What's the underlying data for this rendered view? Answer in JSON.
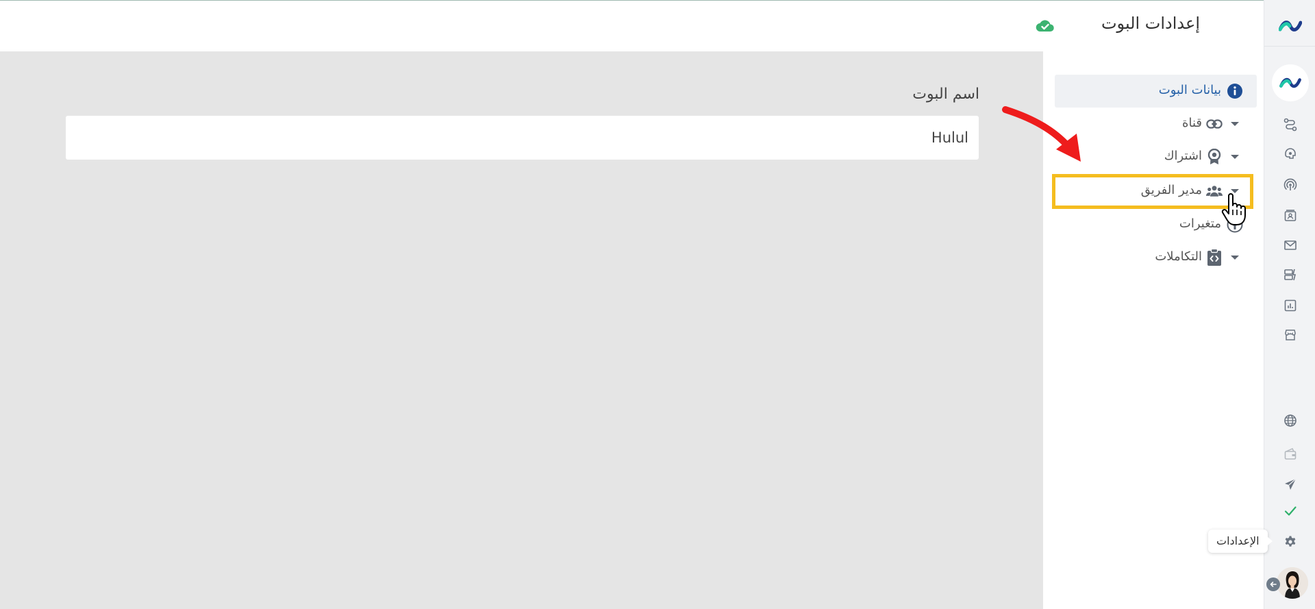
{
  "header": {
    "title": "إعدادات البوت"
  },
  "rail": {
    "tooltip": "الإعدادات",
    "icons": [
      "flow-icon",
      "bot-icon",
      "broadcast-icon",
      "contacts-icon",
      "mail-icon",
      "templates-icon",
      "analytics-icon",
      "store-icon",
      "globe-icon",
      "wallet-icon",
      "send-icon",
      "check-icon",
      "settings-icon"
    ]
  },
  "menu": {
    "items": [
      {
        "label": "بيانات البوت",
        "icon": "info-icon",
        "active": true
      },
      {
        "label": "قناة",
        "icon": "link-icon",
        "caret": true
      },
      {
        "label": "اشتراك",
        "icon": "badge-icon",
        "caret": true
      },
      {
        "label": "مدير الفريق",
        "icon": "team-icon",
        "caret": true
      },
      {
        "label": "متغيرات",
        "icon": "variable-icon"
      },
      {
        "label": "التكاملات",
        "icon": "code-clipboard-icon",
        "caret": true
      }
    ]
  },
  "form": {
    "bot_name_label": "اسم البوت",
    "bot_name_value": "Hulul"
  },
  "colors": {
    "accent_blue": "#2561a8",
    "highlight": "#f5bd1f",
    "arrow_red": "#ee1c1c",
    "success_green": "#3cb371"
  }
}
